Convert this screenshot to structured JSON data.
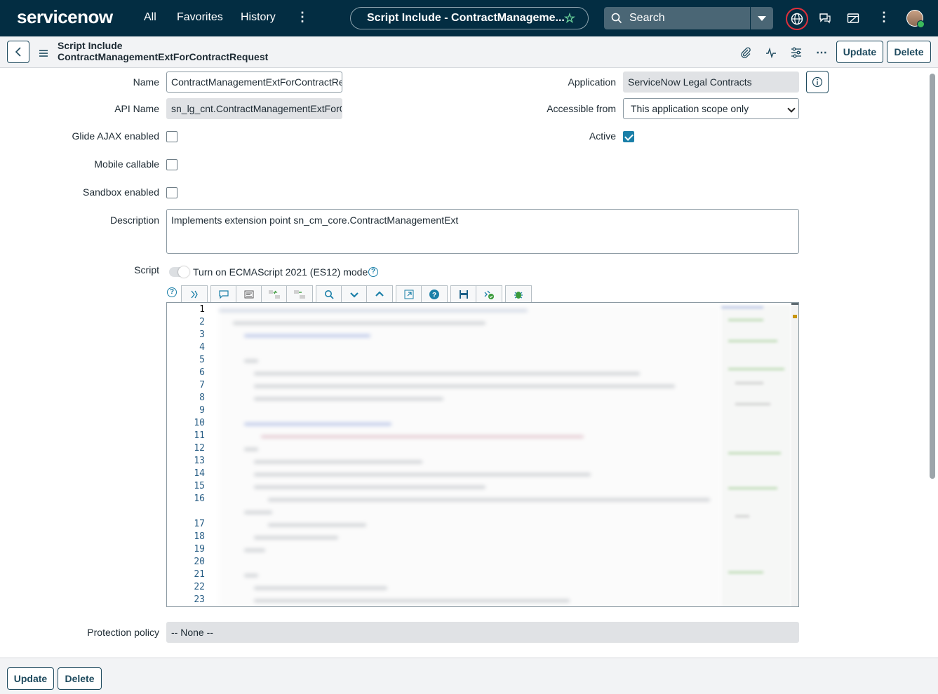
{
  "nav": {
    "logo": "servicenow",
    "links": [
      "All",
      "Favorites",
      "History"
    ],
    "record_title": "Script Include - ContractManageme...",
    "search_placeholder": "Search"
  },
  "header": {
    "record_type": "Script Include",
    "record_name": "ContractManagementExtForContractRequest",
    "update_label": "Update",
    "delete_label": "Delete"
  },
  "form": {
    "name_label": "Name",
    "name_value": "ContractManagementExtForContractRequest",
    "api_name_label": "API Name",
    "api_name_value": "sn_lg_cnt.ContractManagementExtForContractRequest",
    "glide_ajax_label": "Glide AJAX enabled",
    "glide_ajax_checked": false,
    "mobile_callable_label": "Mobile callable",
    "mobile_callable_checked": false,
    "sandbox_label": "Sandbox enabled",
    "sandbox_checked": false,
    "application_label": "Application",
    "application_value": "ServiceNow Legal Contracts",
    "accessible_label": "Accessible from",
    "accessible_value": "This application scope only",
    "active_label": "Active",
    "active_checked": true,
    "description_label": "Description",
    "description_value": "Implements extension point sn_cm_core.ContractManagementExt",
    "script_label": "Script",
    "es12_label": "Turn on ECMAScript 2021 (ES12) mode",
    "protection_label": "Protection policy",
    "protection_value": "-- None --"
  },
  "editor": {
    "line_numbers": [
      "1",
      "2",
      "3",
      "4",
      "5",
      "6",
      "7",
      "8",
      "9",
      "10",
      "11",
      "12",
      "13",
      "14",
      "15",
      "16",
      "17",
      "18",
      "19",
      "20",
      "21",
      "22",
      "23"
    ]
  },
  "footer": {
    "update_label": "Update",
    "delete_label": "Delete"
  },
  "colors": {
    "nav_bg": "#032d42",
    "accent": "#1a7fa8",
    "brand_green": "#6bd59b"
  }
}
